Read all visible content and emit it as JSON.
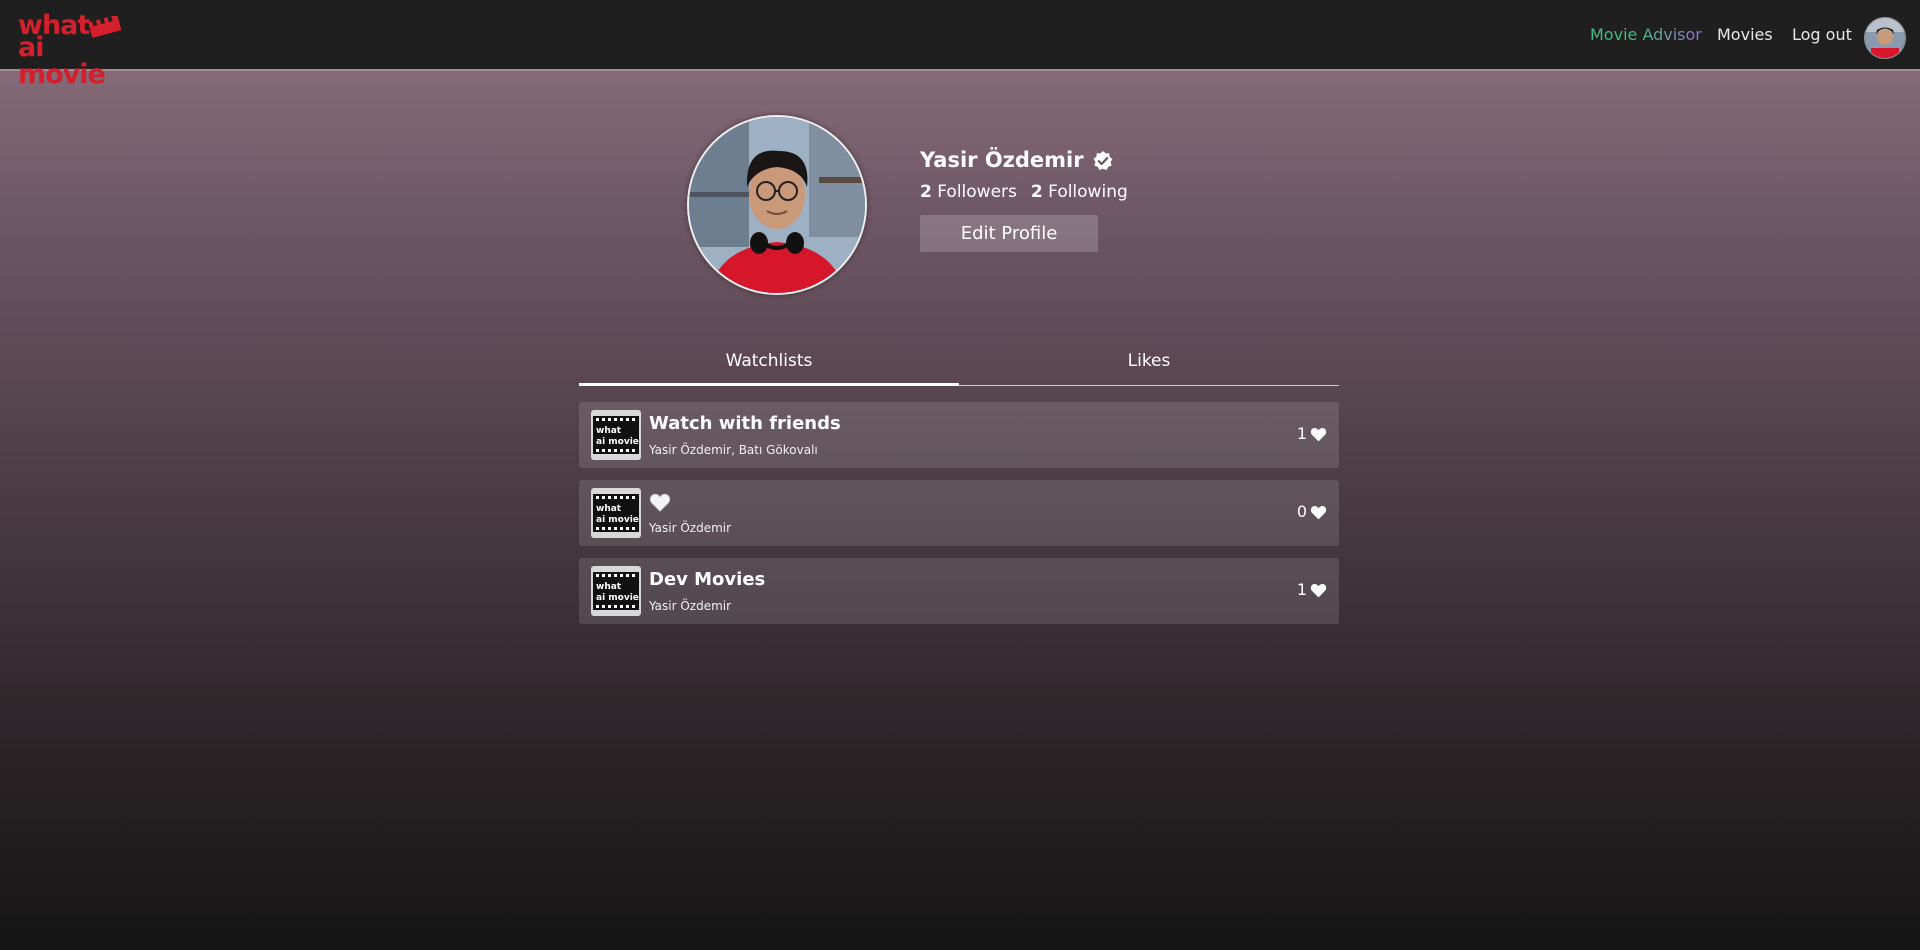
{
  "header": {
    "logo_line1": "what",
    "logo_line2": "ai movie",
    "nav": {
      "advisor": "Movie Advisor",
      "movies": "Movies",
      "logout": "Log out"
    }
  },
  "profile": {
    "name": "Yasir Özdemir",
    "followers_count": "2",
    "followers_label": "Followers",
    "following_count": "2",
    "following_label": "Following",
    "edit_button": "Edit Profile"
  },
  "tabs": {
    "watchlists": "Watchlists",
    "likes": "Likes"
  },
  "watchlists": [
    {
      "title": "Watch with friends",
      "owners": "Yasir Özdemir, Batı Gökovalı",
      "likes": "1"
    },
    {
      "title": "",
      "title_icon": "white-heart-icon",
      "owners": "Yasir Özdemir",
      "likes": "0"
    },
    {
      "title": "Dev Movies",
      "owners": "Yasir Özdemir",
      "likes": "1"
    }
  ],
  "colors": {
    "brand_red": "#d4202c",
    "advisor_green": "#3fbf7f",
    "advisor_purple": "#9a6fd0",
    "topbar": "#1f1f1f"
  }
}
